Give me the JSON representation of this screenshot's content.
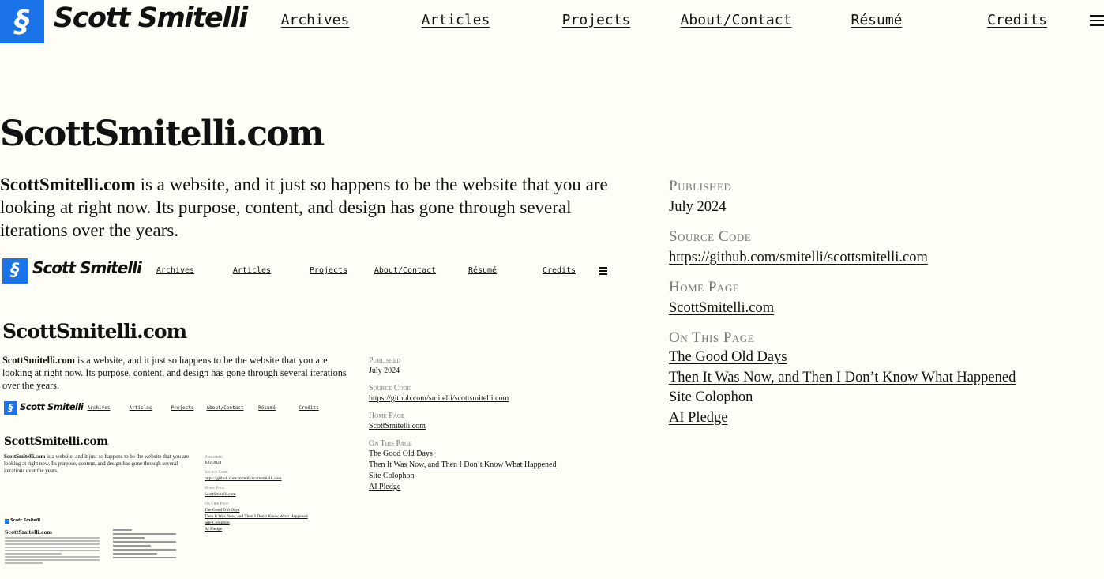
{
  "header": {
    "logo_glyph": "§",
    "site_name": "Scott Smitelli",
    "nav": [
      "Archives",
      "Articles",
      "Projects",
      "About/Contact",
      "Résumé",
      "Credits"
    ],
    "brand_color": "#1a73e8"
  },
  "main": {
    "title": "ScottSmitelli.com",
    "intro_bold": "ScottSmitelli.com",
    "intro_rest": " is a website, and it just so happens to be the website that you are looking at right now. Its purpose, content, and design has gone through several iterations over the years."
  },
  "sidebar": {
    "published_label": "Published",
    "published_value": "July 2024",
    "source_label": "Source Code",
    "source_value": "https://github.com/smitelli/scottsmitelli.com",
    "home_label": "Home Page",
    "home_value": "ScottSmitelli.com",
    "toc_label": "On This Page",
    "toc": [
      "The Good Old Days",
      "Then It Was Now, and Then I Don’t Know What Happened",
      "Site Colophon",
      "AI Pledge"
    ]
  }
}
